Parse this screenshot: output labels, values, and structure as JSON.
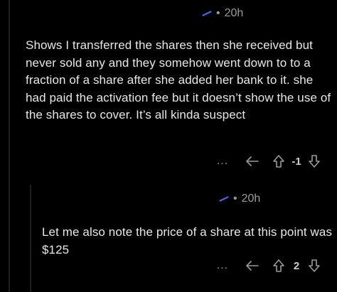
{
  "comment1": {
    "timestamp": "20h",
    "separator": "•",
    "text": "Shows I transferred the shares then she received but never sold any and they somehow went down to to a fraction of a share after she added her bank to it. she had paid the activation fee but it doesn’t show the use of the shares to cover. It’s all kinda suspect",
    "more_label": "...",
    "score": "-1"
  },
  "comment2": {
    "timestamp": "20h",
    "separator": "•",
    "text": "Let me also note the price of a share at this point was $125",
    "more_label": "...",
    "score": "2"
  },
  "colors": {
    "background": "#000000",
    "text": "#e8e8e8",
    "muted": "#9a9a9a",
    "user_accent": "#4a6cff"
  },
  "icons": [
    "reply-icon",
    "upvote-icon",
    "downvote-icon",
    "more-options-icon"
  ]
}
